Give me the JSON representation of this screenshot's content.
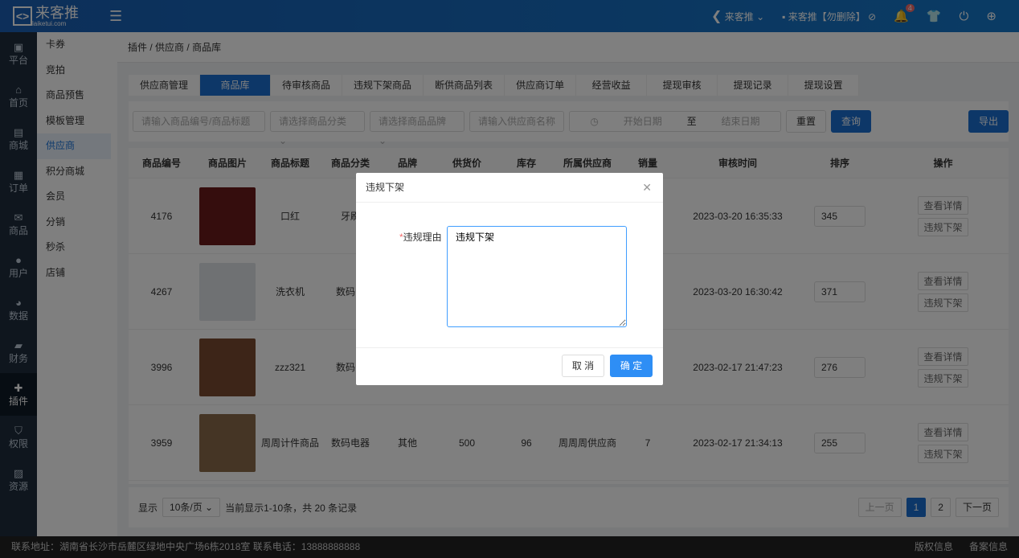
{
  "header": {
    "logo_text": "来客推",
    "logo_sub": "laiketui.com",
    "store": "来客推",
    "user": "来客推【勿删除】",
    "notif_count": "4"
  },
  "sidebar": [
    {
      "label": "平台",
      "icon": "monitor-icon"
    },
    {
      "label": "首页",
      "icon": "home-icon"
    },
    {
      "label": "商城",
      "icon": "store-icon"
    },
    {
      "label": "订单",
      "icon": "order-icon"
    },
    {
      "label": "商品",
      "icon": "goods-icon"
    },
    {
      "label": "用户",
      "icon": "user-icon"
    },
    {
      "label": "数据",
      "icon": "pie-chart-icon"
    },
    {
      "label": "财务",
      "icon": "wallet-icon"
    },
    {
      "label": "插件",
      "icon": "puzzle-icon",
      "active": true
    },
    {
      "label": "权限",
      "icon": "shield-icon"
    },
    {
      "label": "资源",
      "icon": "image-icon"
    }
  ],
  "submenu": [
    "卡券",
    "竞拍",
    "商品预售",
    "模板管理",
    "供应商",
    "积分商城",
    "会员",
    "分销",
    "秒杀",
    "店铺"
  ],
  "submenu_active": 4,
  "breadcrumb": [
    "插件",
    "供应商",
    "商品库"
  ],
  "tabs": [
    "供应商管理",
    "商品库",
    "待审核商品",
    "违规下架商品",
    "断供商品列表",
    "供应商订单",
    "经营收益",
    "提现审核",
    "提现记录",
    "提现设置"
  ],
  "tab_active": 1,
  "filter": {
    "keyword_ph": "请输入商品编号/商品标题",
    "category_ph": "请选择商品分类",
    "brand_ph": "请选择商品品牌",
    "supplier_ph": "请输入供应商名称",
    "start_ph": "开始日期",
    "to": "至",
    "end_ph": "结束日期",
    "reset": "重置",
    "query": "查询",
    "export": "导出"
  },
  "table": {
    "headers": [
      "商品编号",
      "商品图片",
      "商品标题",
      "商品分类",
      "品牌",
      "供货价",
      "库存",
      "所属供应商",
      "销量",
      "审核时间",
      "排序",
      "操作"
    ],
    "rows": [
      {
        "id": "4176",
        "title": "口红",
        "category": "牙刷",
        "brand": "",
        "price": "",
        "stock": "",
        "supplier": "",
        "sales": "",
        "time": "2023-03-20 16:35:33",
        "sort": "345",
        "img": "#6b1a1a"
      },
      {
        "id": "4267",
        "title": "洗衣机",
        "category": "数码电",
        "brand": "",
        "price": "",
        "stock": "",
        "supplier": "",
        "sales": "",
        "time": "2023-03-20 16:30:42",
        "sort": "371",
        "img": "#dfe3e6"
      },
      {
        "id": "3996",
        "title": "zzz321",
        "category": "数码电",
        "brand": "",
        "price": "",
        "stock": "",
        "supplier": "",
        "sales": "",
        "time": "2023-02-17 21:47:23",
        "sort": "276",
        "img": "#7a4a30"
      },
      {
        "id": "3959",
        "title": "周周计件商品",
        "category": "数码电器",
        "brand": "其他",
        "price": "500",
        "stock": "96",
        "supplier": "周周周供应商",
        "sales": "7",
        "time": "2023-02-17 21:34:13",
        "sort": "255",
        "img": "#8a6a4a"
      }
    ],
    "op_detail": "查看详情",
    "op_off": "违规下架"
  },
  "pager": {
    "show": "显示",
    "size": "10条/页",
    "summary": "当前显示1-10条，共 20 条记录",
    "prev": "上一页",
    "pages": [
      "1",
      "2"
    ],
    "next": "下一页"
  },
  "footer": {
    "address": "联系地址：湖南省长沙市岳麓区绿地中央广场6栋2018室 联系电话：13888888888",
    "copyright": "版权信息",
    "icp": "备案信息"
  },
  "modal": {
    "title": "违规下架",
    "label": "违规理由",
    "required": "*",
    "value": "违规下架",
    "cancel": "取 消",
    "confirm": "确 定"
  }
}
